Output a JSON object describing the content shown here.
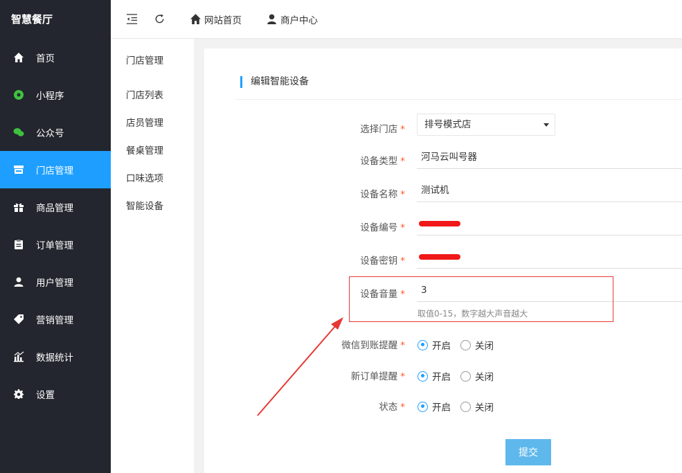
{
  "sidebar": {
    "brand": "智慧餐厅",
    "items": [
      {
        "label": "首页",
        "icon": "home-icon"
      },
      {
        "label": "小程序",
        "icon": "miniprogram-icon"
      },
      {
        "label": "公众号",
        "icon": "wechat-icon"
      },
      {
        "label": "门店管理",
        "icon": "store-icon",
        "active": true
      },
      {
        "label": "商品管理",
        "icon": "gift-icon"
      },
      {
        "label": "订单管理",
        "icon": "clipboard-icon"
      },
      {
        "label": "用户管理",
        "icon": "user-icon"
      },
      {
        "label": "营销管理",
        "icon": "tag-icon"
      },
      {
        "label": "数据统计",
        "icon": "chart-icon"
      },
      {
        "label": "设置",
        "icon": "gear-icon"
      }
    ]
  },
  "header": {
    "home_label": "网站首页",
    "merchant_label": "商户中心"
  },
  "submenu": {
    "title": "门店管理",
    "items": [
      "门店列表",
      "店员管理",
      "餐桌管理",
      "口味选项",
      "智能设备"
    ]
  },
  "form": {
    "section_title": "编辑智能设备",
    "required_mark": "*",
    "store_label": "选择门店",
    "store_value": "排号模式店",
    "type_label": "设备类型",
    "type_value": "河马云叫号器",
    "name_label": "设备名称",
    "name_value": "测试机",
    "code_label": "设备编号",
    "secret_label": "设备密钥",
    "volume_label": "设备音量",
    "volume_value": "3",
    "volume_hint": "取值0-15，数字越大声音越大",
    "wechat_label": "微信到账提醒",
    "order_label": "新订单提醒",
    "status_label": "状态",
    "on_label": "开启",
    "off_label": "关闭",
    "submit_label": "提交"
  },
  "colors": {
    "sidebar_bg": "#23262e",
    "accent": "#1e9fff",
    "annotation_red": "#e53935",
    "submit_bg": "#5fb8ec"
  }
}
